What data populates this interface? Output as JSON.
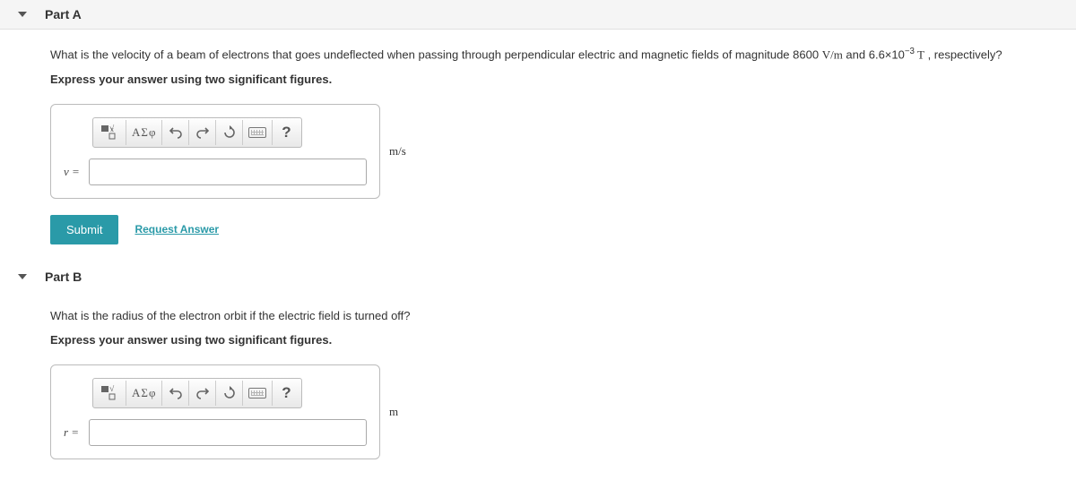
{
  "partA": {
    "title": "Part A",
    "question_prefix": "What is the velocity of a beam of electrons that goes undeflected when passing through perpendicular electric and magnetic fields of magnitude 8600 ",
    "q_unit1": "V/m",
    "q_mid": " and 6.6×10",
    "q_exp": "−3",
    "q_unit2": " T",
    "q_suffix": " , respectively?",
    "instruction": "Express your answer using two significant figures.",
    "var": "v =",
    "value": "",
    "unit": "m/s",
    "submit": "Submit",
    "request": "Request Answer"
  },
  "partB": {
    "title": "Part B",
    "question": "What is the radius of the electron orbit if the electric field is turned off?",
    "instruction": "Express your answer using two significant figures.",
    "var": "r =",
    "value": "",
    "unit": "m"
  },
  "toolbar": {
    "greek": "ΑΣφ",
    "help": "?"
  }
}
